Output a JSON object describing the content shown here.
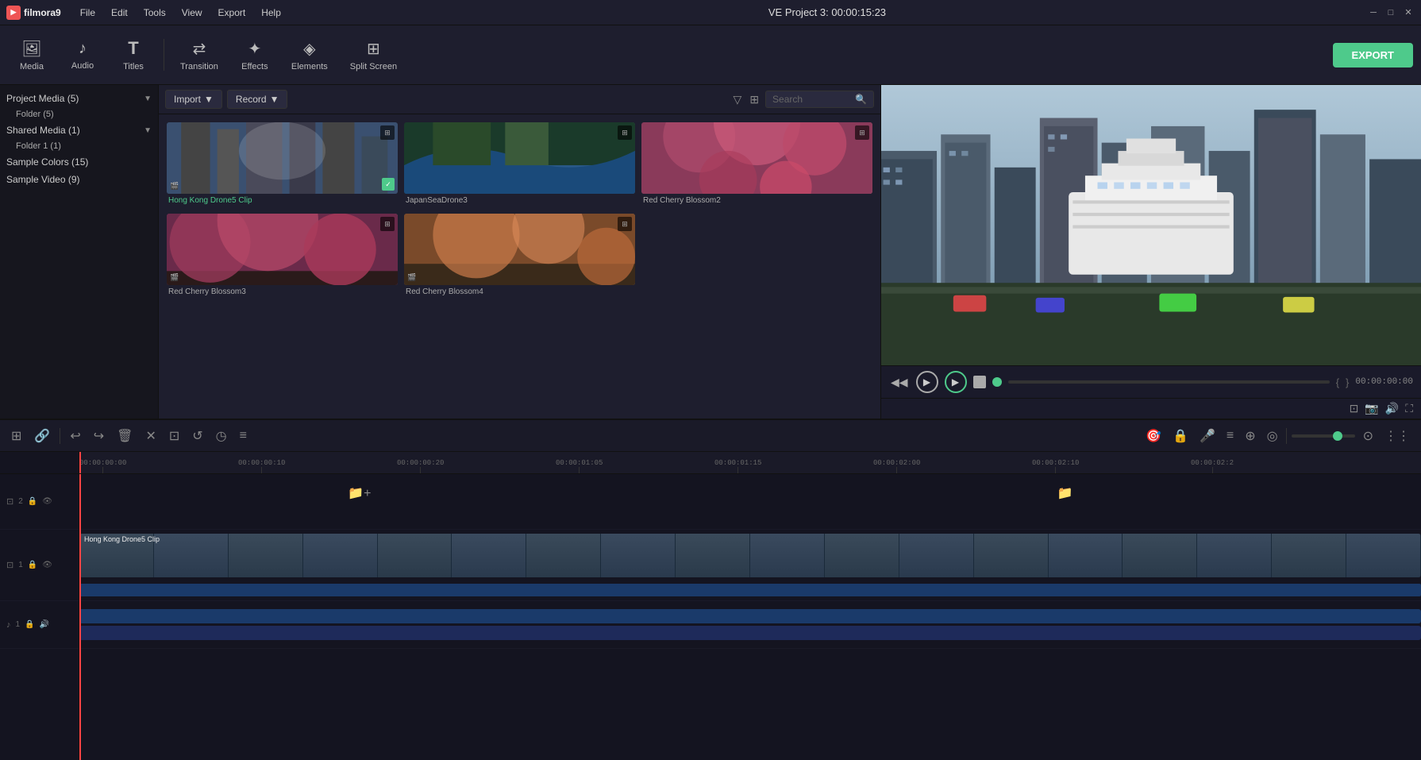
{
  "app": {
    "name": "filmora9",
    "title": "VE Project 3: 00:00:15:23"
  },
  "menu": {
    "items": [
      "File",
      "Edit",
      "Tools",
      "View",
      "Export",
      "Help"
    ]
  },
  "window": {
    "minimize": "─",
    "maximize": "□",
    "close": "✕"
  },
  "toolbar": {
    "items": [
      {
        "id": "media",
        "icon": "🖼",
        "label": "Media"
      },
      {
        "id": "audio",
        "icon": "♪",
        "label": "Audio"
      },
      {
        "id": "titles",
        "icon": "T",
        "label": "Titles"
      },
      {
        "id": "transition",
        "icon": "⇄",
        "label": "Transition"
      },
      {
        "id": "effects",
        "icon": "✦",
        "label": "Effects"
      },
      {
        "id": "elements",
        "icon": "◈",
        "label": "Elements"
      },
      {
        "id": "splitscreen",
        "icon": "⊞",
        "label": "Split Screen"
      }
    ],
    "export_label": "EXPORT"
  },
  "sidebar": {
    "sections": [
      {
        "label": "Project Media (5)",
        "expanded": true,
        "children": [
          {
            "label": "Folder (5)"
          }
        ]
      },
      {
        "label": "Shared Media (1)",
        "expanded": true,
        "children": [
          {
            "label": "Folder 1 (1)"
          }
        ]
      },
      {
        "label": "Sample Colors (15)",
        "expanded": false,
        "children": []
      },
      {
        "label": "Sample Video (9)",
        "expanded": false,
        "children": []
      }
    ]
  },
  "media_panel": {
    "import_label": "Import",
    "record_label": "Record",
    "search_placeholder": "Search",
    "items": [
      {
        "id": "hk",
        "name": "Hong Kong Drone5 Clip",
        "selected": true,
        "thumb_class": "thumb-hk"
      },
      {
        "id": "japan",
        "name": "JapanSeaDrone3",
        "selected": false,
        "thumb_class": "thumb-japan"
      },
      {
        "id": "cherry2",
        "name": "Red Cherry Blossom2",
        "selected": false,
        "thumb_class": "thumb-cherry1"
      },
      {
        "id": "cherry3",
        "name": "Red Cherry Blossom3",
        "selected": false,
        "thumb_class": "thumb-cherry3"
      },
      {
        "id": "cherry4",
        "name": "Red Cherry Blossom4",
        "selected": false,
        "thumb_class": "thumb-cherry4"
      }
    ]
  },
  "preview": {
    "time_display": "00:00:00:00",
    "title": "VE Project 3: 00:00:15:23"
  },
  "timeline": {
    "toolbar_tools": [
      "↩",
      "↪",
      "🗑",
      "✕",
      "⊡",
      "↺",
      "◷",
      "≡"
    ],
    "right_tools": [
      "🎯",
      "🔒",
      "🎤",
      "≡",
      "⊕",
      "◎"
    ],
    "tracks": [
      {
        "num": "2",
        "icon": "⊡",
        "label": "",
        "type": "video-empty"
      },
      {
        "num": "1",
        "icon": "⊡",
        "label": "Hong Kong Drone5 Clip",
        "type": "video-full"
      },
      {
        "num": "1",
        "icon": "♪",
        "label": "",
        "type": "audio"
      }
    ],
    "ruler_marks": [
      {
        "time": "00:00:00:00",
        "pos": 0
      },
      {
        "time": "00:00:00:10",
        "pos": 200
      },
      {
        "time": "00:00:00:20",
        "pos": 400
      },
      {
        "time": "00:00:01:05",
        "pos": 600
      },
      {
        "time": "00:00:01:15",
        "pos": 800
      },
      {
        "time": "00:00:02:00",
        "pos": 1000
      },
      {
        "time": "00:00:02:10",
        "pos": 1200
      },
      {
        "time": "00:00:02:2",
        "pos": 1400
      }
    ]
  }
}
